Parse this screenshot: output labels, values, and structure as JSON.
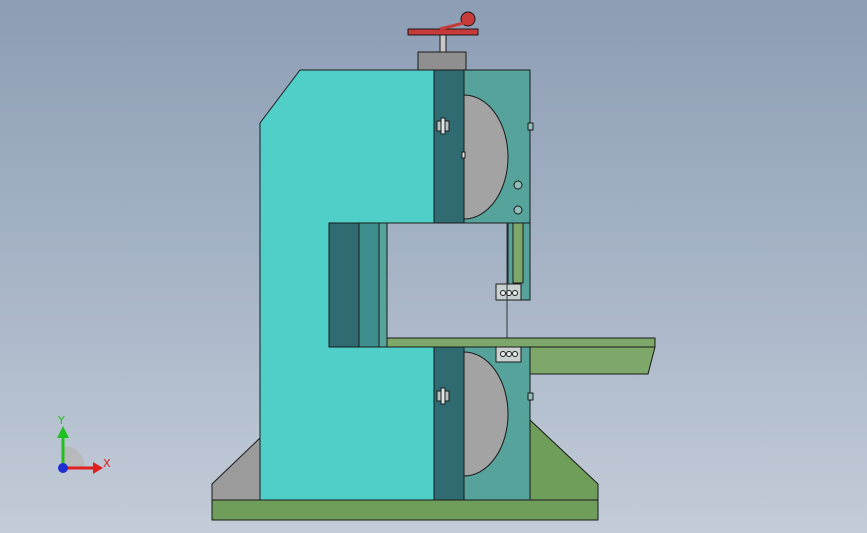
{
  "viewport": {
    "background_top": "#8c9db4",
    "background_bottom": "#c3ccd8"
  },
  "model": {
    "name": "band-saw",
    "colors": {
      "frame": "#4fcfc8",
      "frame_dark": "#2f6b70",
      "frame_mid": "#3d8e8c",
      "housing": "#56a39c",
      "wheel": "#a3a3a3",
      "base": "#6f9d5a",
      "base_side": "#9b9b9b",
      "table": "#7ea76a",
      "tensioner": "#c83a3a",
      "cap": "#8f8f8f",
      "outline": "#1a1a1a"
    }
  },
  "triad": {
    "x_label": "X",
    "y_label": "Y",
    "x_color": "#e02020",
    "y_color": "#20c020",
    "z_color": "#2030d0"
  }
}
